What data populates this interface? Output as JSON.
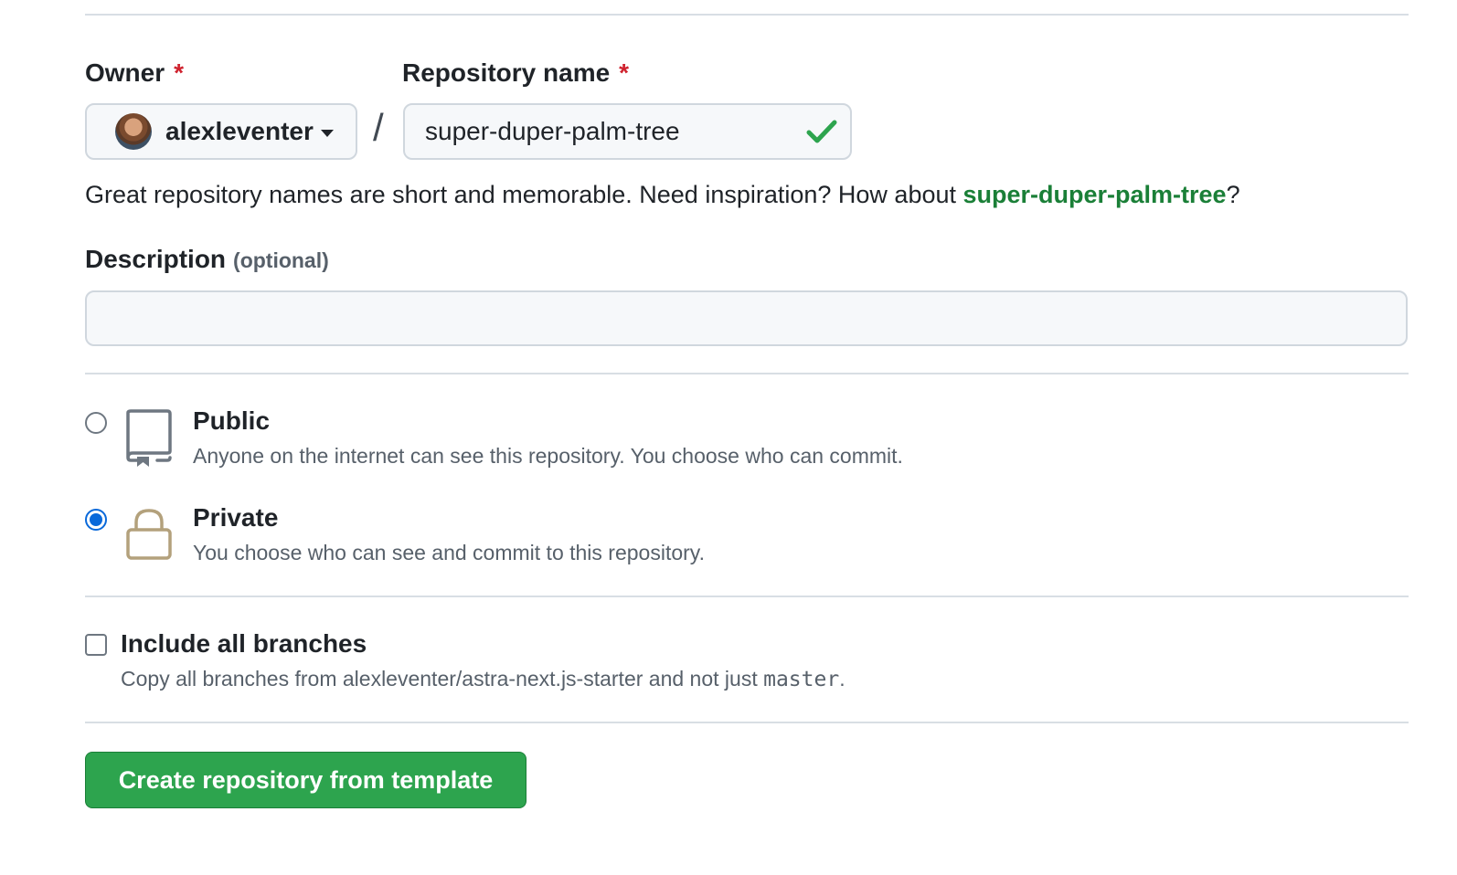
{
  "owner": {
    "label": "Owner",
    "required_mark": "*",
    "selected": "alexleventer"
  },
  "separator": "/",
  "repository": {
    "label": "Repository name",
    "required_mark": "*",
    "value": "super-duper-palm-tree",
    "valid": true
  },
  "hint": {
    "prefix": "Great repository names are short and memorable. Need inspiration? How about ",
    "suggestion": "super-duper-palm-tree",
    "suffix": "?"
  },
  "description": {
    "label": "Description",
    "optional": "(optional)",
    "value": ""
  },
  "visibility": {
    "selected": "private",
    "public": {
      "title": "Public",
      "desc": "Anyone on the internet can see this repository. You choose who can commit.",
      "icon": "repo-icon"
    },
    "private": {
      "title": "Private",
      "desc": "You choose who can see and commit to this repository.",
      "icon": "lock-icon"
    }
  },
  "branches": {
    "title": "Include all branches",
    "desc_prefix": "Copy all branches from alexleventer/astra-next.js-starter and not just ",
    "branch_code": "master",
    "desc_suffix": ".",
    "checked": false
  },
  "submit": {
    "label": "Create repository from template"
  },
  "colors": {
    "success_green": "#2da44e",
    "link_green": "#1a7f37",
    "accent_blue": "#0969da",
    "required_red": "#cf222e"
  }
}
